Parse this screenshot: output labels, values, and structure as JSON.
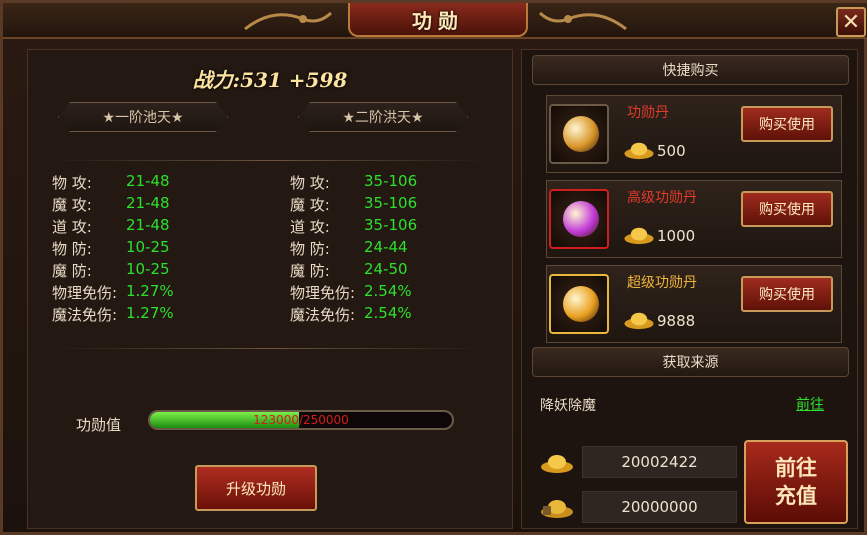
{
  "window": {
    "title": "功勋",
    "close_icon": "close-icon"
  },
  "power": {
    "text": "战力:531 +598"
  },
  "tiers": {
    "current": "★一阶池天★",
    "next": "★二阶洪天★"
  },
  "stats_current": [
    {
      "label": "物  攻:",
      "value": "21-48"
    },
    {
      "label": "魔  攻:",
      "value": "21-48"
    },
    {
      "label": "道  攻:",
      "value": "21-48"
    },
    {
      "label": "物  防:",
      "value": "10-25"
    },
    {
      "label": "魔  防:",
      "value": "10-25"
    },
    {
      "label": "物理免伤:",
      "value": "1.27%"
    },
    {
      "label": "魔法免伤:",
      "value": "1.27%"
    }
  ],
  "stats_next": [
    {
      "label": "物  攻:",
      "value": "35-106"
    },
    {
      "label": "魔  攻:",
      "value": "35-106"
    },
    {
      "label": "道  攻:",
      "value": "35-106"
    },
    {
      "label": "物  防:",
      "value": "24-44"
    },
    {
      "label": "魔  防:",
      "value": "24-50"
    },
    {
      "label": "物理免伤:",
      "value": "2.54%"
    },
    {
      "label": "魔法免伤:",
      "value": "2.54%"
    }
  ],
  "merit": {
    "label": "功勋值",
    "progress_text": "123000/250000",
    "progress_fraction": 0.492
  },
  "upgrade_button": "升级功勋",
  "quick_buy": {
    "title": "快捷购买",
    "items": [
      {
        "name": "功勋丹",
        "price": "500",
        "button": "购买使用",
        "name_color": "#e03a2a",
        "frame_color": "#6c5a49",
        "orb_color": "#d8952a"
      },
      {
        "name": "高级功勋丹",
        "price": "1000",
        "button": "购买使用",
        "name_color": "#e03a2a",
        "frame_color": "#d11d1d",
        "orb_color": "#c23ad8"
      },
      {
        "name": "超级功勋丹",
        "price": "9888",
        "button": "购买使用",
        "name_color": "#f0b43a",
        "frame_color": "#e8b83a",
        "orb_color": "#e8a020"
      }
    ]
  },
  "source": {
    "title": "获取来源",
    "name": "降妖除魔",
    "link": "前往"
  },
  "currency": {
    "gold": "20002422",
    "bound_gold": "20000000"
  },
  "recharge_button": {
    "line1": "前往",
    "line2": "充值"
  }
}
